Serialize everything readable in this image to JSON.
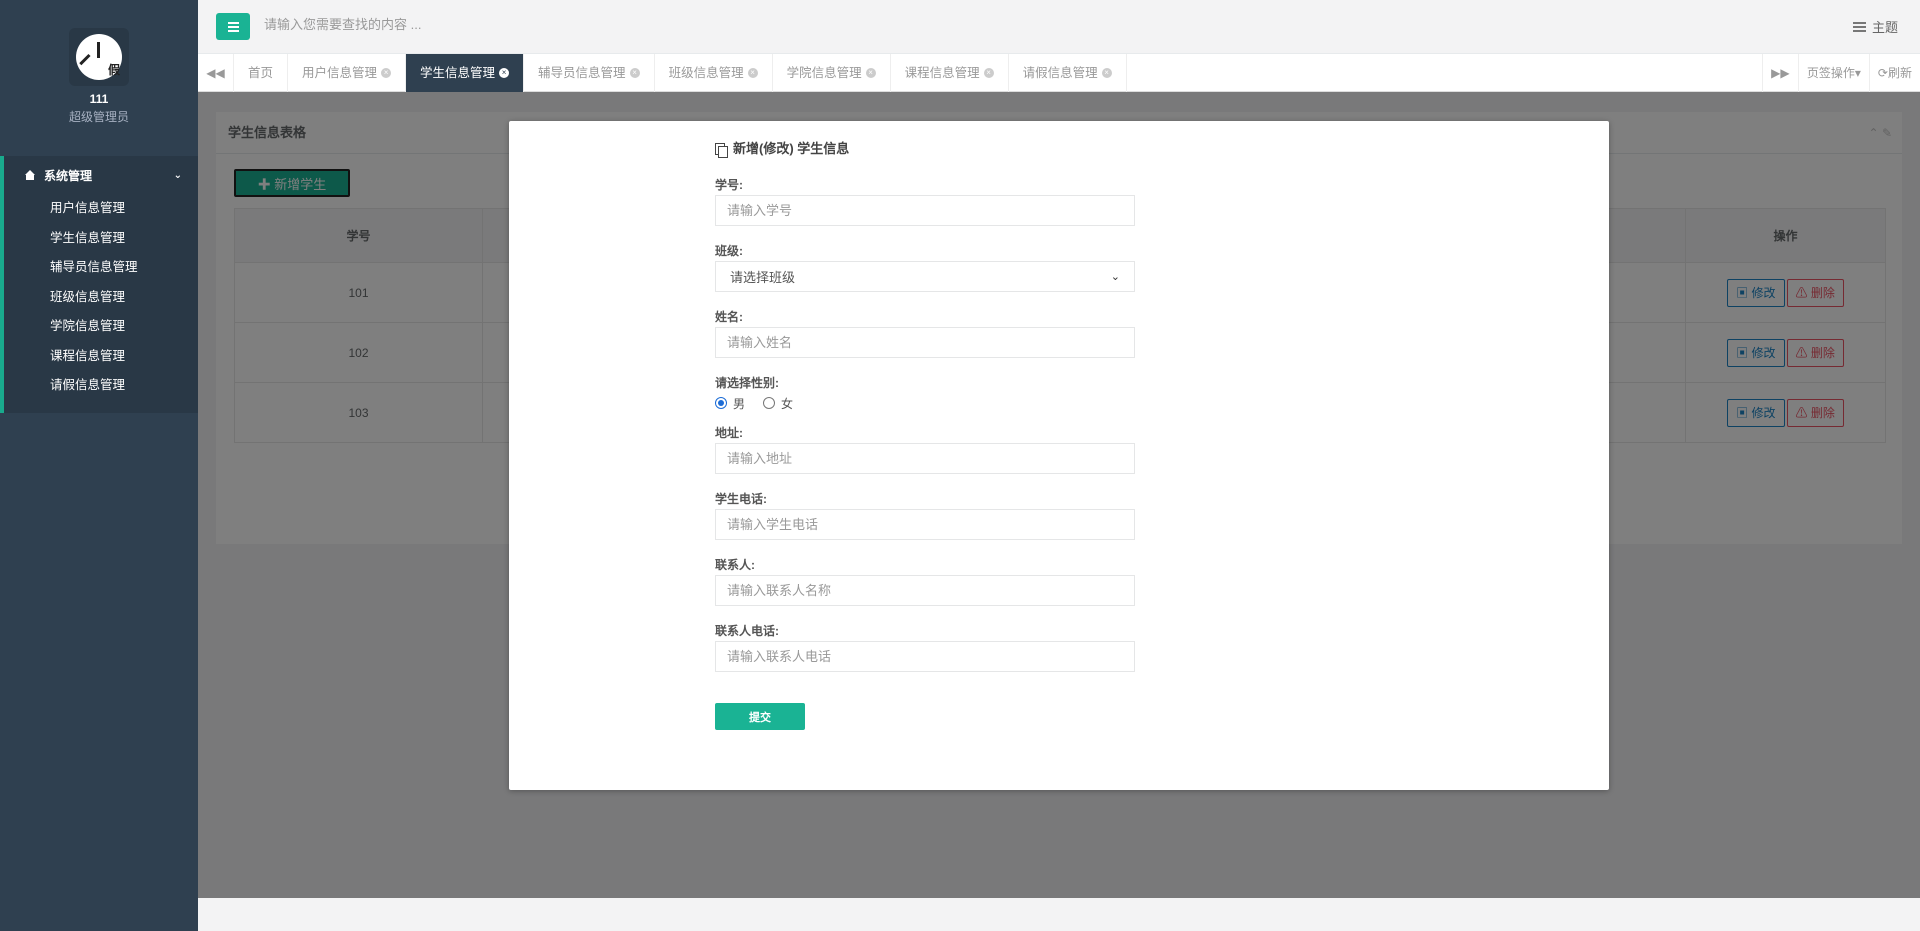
{
  "sidebar": {
    "profile_name": "111",
    "profile_role": "超级管理员",
    "logo_char": "假",
    "menu_title": "系统管理",
    "items": [
      {
        "label": "用户信息管理"
      },
      {
        "label": "学生信息管理"
      },
      {
        "label": "辅导员信息管理"
      },
      {
        "label": "班级信息管理"
      },
      {
        "label": "学院信息管理"
      },
      {
        "label": "课程信息管理"
      },
      {
        "label": "请假信息管理"
      }
    ]
  },
  "topbar": {
    "search_placeholder": "请输入您需要查找的内容 ...",
    "theme_label": "主题"
  },
  "tabs": {
    "items": [
      {
        "label": "首页",
        "active": false
      },
      {
        "label": "用户信息管理",
        "active": false
      },
      {
        "label": "学生信息管理",
        "active": true
      },
      {
        "label": "辅导员信息管理",
        "active": false
      },
      {
        "label": "班级信息管理",
        "active": false
      },
      {
        "label": "学院信息管理",
        "active": false
      },
      {
        "label": "课程信息管理",
        "active": false
      },
      {
        "label": "请假信息管理",
        "active": false
      }
    ],
    "page_ops": "页签操作",
    "refresh": "刷新"
  },
  "main": {
    "panel_title": "学生信息表格",
    "add_button": "✚ 新增学生",
    "columns": [
      "学号",
      "操作"
    ],
    "rows": [
      {
        "id": "101"
      },
      {
        "id": "102"
      },
      {
        "id": "103"
      }
    ],
    "edit_label": "修改",
    "delete_label": "删除"
  },
  "modal": {
    "title": "新增(修改) 学生信息",
    "fields": {
      "student_no": {
        "label": "学号:",
        "placeholder": "请输入学号"
      },
      "class": {
        "label": "班级:",
        "selected": "请选择班级"
      },
      "name": {
        "label": "姓名:",
        "placeholder": "请输入姓名"
      },
      "gender": {
        "label": "请选择性别:",
        "options": [
          "男",
          "女"
        ],
        "selected": "男"
      },
      "address": {
        "label": "地址:",
        "placeholder": "请输入地址"
      },
      "phone": {
        "label": "学生电话:",
        "placeholder": "请输入学生电话"
      },
      "contact": {
        "label": "联系人:",
        "placeholder": "请输入联系人名称"
      },
      "contact_phone": {
        "label": "联系人电话:",
        "placeholder": "请输入联系人电话"
      }
    },
    "submit_label": "提交"
  },
  "colors": {
    "sidebar_bg": "#2f4050",
    "accent": "#1ab394",
    "edit": "#1c84c6",
    "delete": "#ed5565"
  }
}
